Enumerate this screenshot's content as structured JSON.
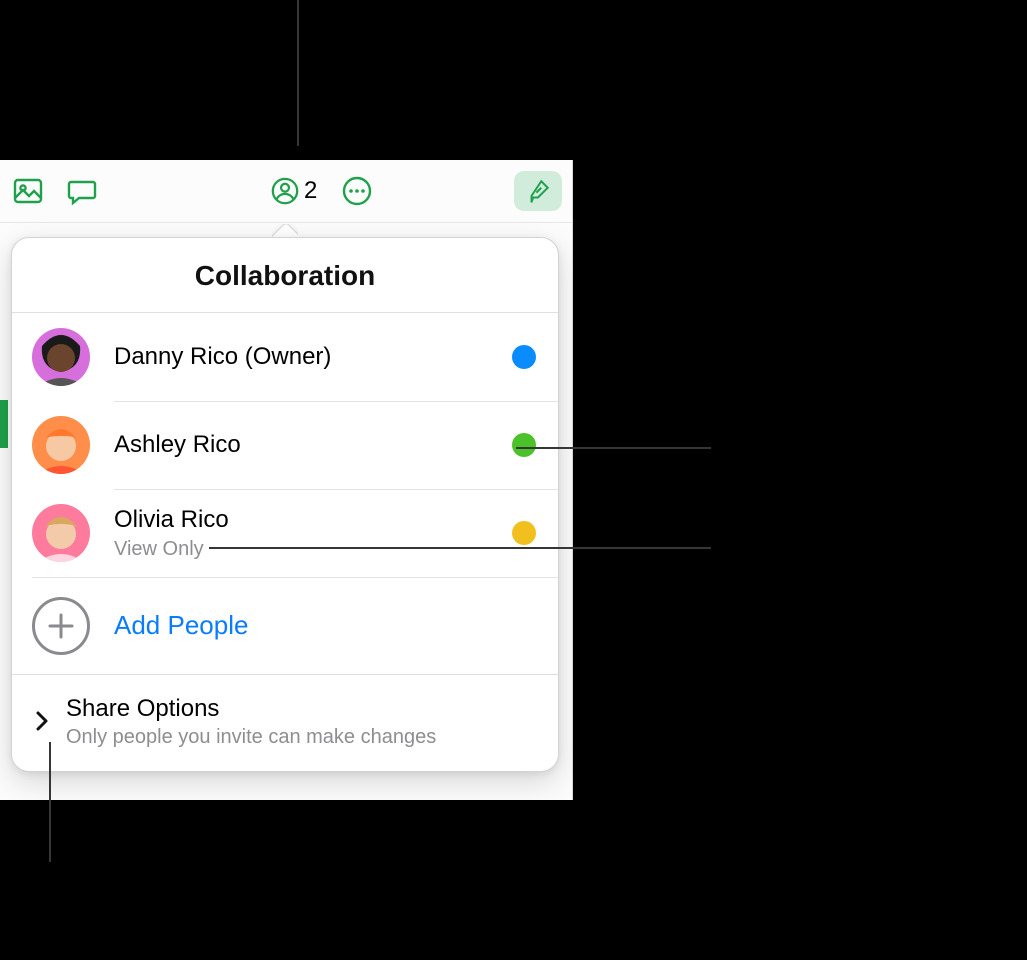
{
  "toolbar": {
    "collab_count": "2"
  },
  "popover": {
    "title": "Collaboration",
    "add_people_label": "Add People",
    "share": {
      "title": "Share Options",
      "subtitle": "Only people you invite can make changes"
    },
    "people": [
      {
        "name": "Danny Rico (Owner)",
        "sub": "",
        "dot_color": "#0a8cff",
        "avatar_bg": "#d66fdc",
        "avatar_skin": "#6a442c",
        "avatar_hair": "#1a1a1a"
      },
      {
        "name": "Ashley Rico",
        "sub": "",
        "dot_color": "#4cc22a",
        "avatar_bg": "#ff8e4a",
        "avatar_skin": "#f6c8a4",
        "avatar_hair": "#ff782b"
      },
      {
        "name": "Olivia Rico",
        "sub": "View Only",
        "dot_color": "#f2c01e",
        "avatar_bg": "#ff7b9e",
        "avatar_skin": "#f3cbaa",
        "avatar_hair": "#d9a85f"
      }
    ]
  }
}
